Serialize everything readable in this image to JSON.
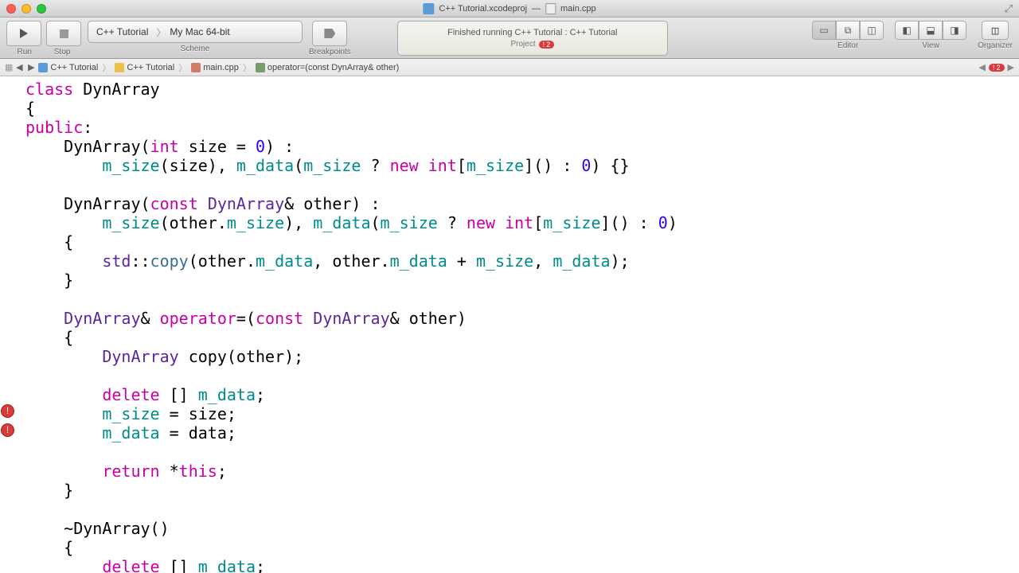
{
  "titlebar": {
    "project": "C++ Tutorial.xcodeproj",
    "dash": "—",
    "file": "main.cpp"
  },
  "toolbar": {
    "run_label": "Run",
    "stop_label": "Stop",
    "scheme": {
      "proj": "C++ Tutorial",
      "dest": "My Mac 64-bit",
      "label": "Scheme"
    },
    "breakpoints_label": "Breakpoints",
    "status": {
      "line1": "Finished running C++ Tutorial : C++ Tutorial",
      "proj": "Project",
      "err_count": "2"
    },
    "editor_label": "Editor",
    "view_label": "View",
    "organizer_label": "Organizer"
  },
  "jumpbar": {
    "c1": "C++ Tutorial",
    "c2": "C++ Tutorial",
    "c3": "main.cpp",
    "c4": "operator=(const DynArray& other)",
    "err_count": "2"
  },
  "code": {
    "l1a": "class",
    "l1b": " DynArray",
    "l2": "{",
    "l3a": "public",
    "l3b": ":",
    "l4a": "    DynArray(",
    "l4b": "int",
    "l4c": " size = ",
    "l4d": "0",
    "l4e": ") :",
    "l5a": "        ",
    "l5b": "m_size",
    "l5c": "(size), ",
    "l5d": "m_data",
    "l5e": "(",
    "l5f": "m_size",
    "l5g": " ? ",
    "l5h": "new",
    "l5i": " ",
    "l5j": "int",
    "l5k": "[",
    "l5l": "m_size",
    "l5m": "]() : ",
    "l5n": "0",
    "l5o": ") {}",
    "l7a": "    DynArray(",
    "l7b": "const",
    "l7c": " ",
    "l7d": "DynArray",
    "l7e": "& other) :",
    "l8a": "        ",
    "l8b": "m_size",
    "l8c": "(other.",
    "l8d": "m_size",
    "l8e": "), ",
    "l8f": "m_data",
    "l8g": "(",
    "l8h": "m_size",
    "l8i": " ? ",
    "l8j": "new",
    "l8k": " ",
    "l8l": "int",
    "l8m": "[",
    "l8n": "m_size",
    "l8o": "]() : ",
    "l8p": "0",
    "l8q": ")",
    "l9": "    {",
    "l10a": "        ",
    "l10b": "std",
    "l10c": "::",
    "l10d": "copy",
    "l10e": "(other.",
    "l10f": "m_data",
    "l10g": ", other.",
    "l10h": "m_data",
    "l10i": " + ",
    "l10j": "m_size",
    "l10k": ", ",
    "l10l": "m_data",
    "l10m": ");",
    "l11": "    }",
    "l13a": "    ",
    "l13b": "DynArray",
    "l13c": "& ",
    "l13d": "operator",
    "l13e": "=(",
    "l13f": "const",
    "l13g": " ",
    "l13h": "DynArray",
    "l13i": "& other)",
    "l14": "    {",
    "l15a": "        ",
    "l15b": "DynArray",
    "l15c": " copy(other);",
    "l17a": "        ",
    "l17b": "delete",
    "l17c": " [] ",
    "l17d": "m_data",
    "l17e": ";",
    "l18a": "        ",
    "l18b": "m_size",
    "l18c": " = size;",
    "l19a": "        ",
    "l19b": "m_data",
    "l19c": " = data;",
    "l21a": "        ",
    "l21b": "return",
    "l21c": " *",
    "l21d": "this",
    "l21e": ";",
    "l22": "    }",
    "l24": "    ~DynArray()",
    "l25": "    {",
    "l26a": "        ",
    "l26b": "delete",
    "l26c": " [] ",
    "l26d": "m_data",
    "l26e": ";"
  }
}
